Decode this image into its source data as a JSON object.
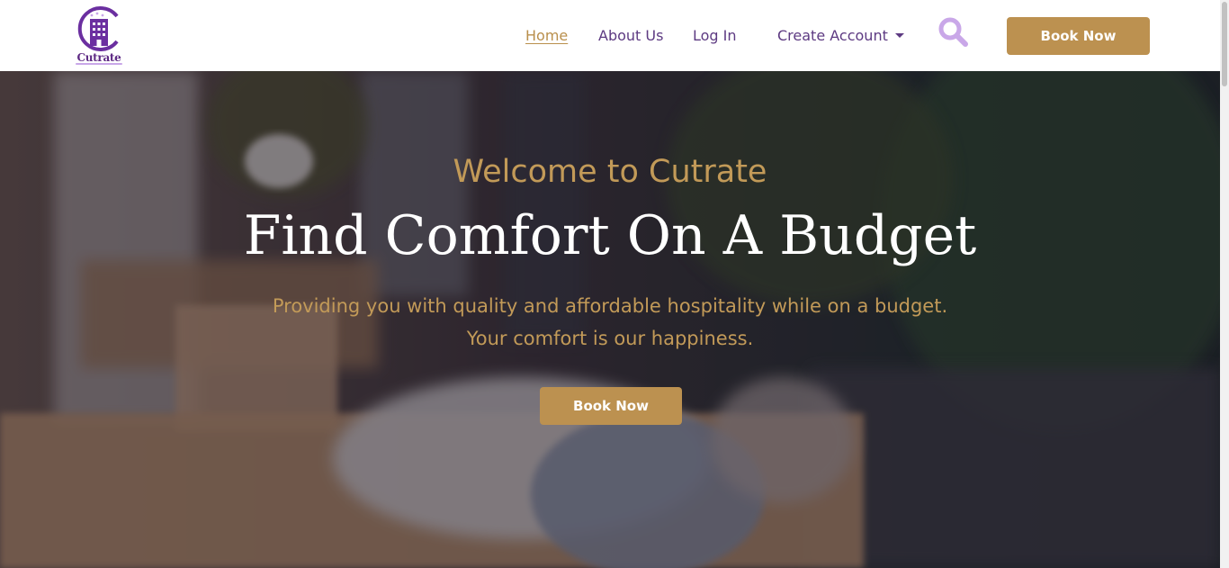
{
  "brand": {
    "name": "Cutrate",
    "logo_icon": "hotel-building-icon"
  },
  "nav": {
    "home": "Home",
    "about": "About Us",
    "login": "Log In",
    "create_account": "Create Account",
    "search_icon": "search-icon",
    "book_now": "Book Now"
  },
  "hero": {
    "welcome": "Welcome to Cutrate",
    "title": "Find Comfort On A Budget",
    "subtitle_line1": "Providing you with quality and affordable hospitality while on a budget.",
    "subtitle_line2": "Your comfort is our happiness.",
    "book_now": "Book Now"
  },
  "colors": {
    "accent_gold": "#bc9150",
    "brand_purple": "#5d3a82",
    "search_lavender": "#c9a7e8"
  }
}
